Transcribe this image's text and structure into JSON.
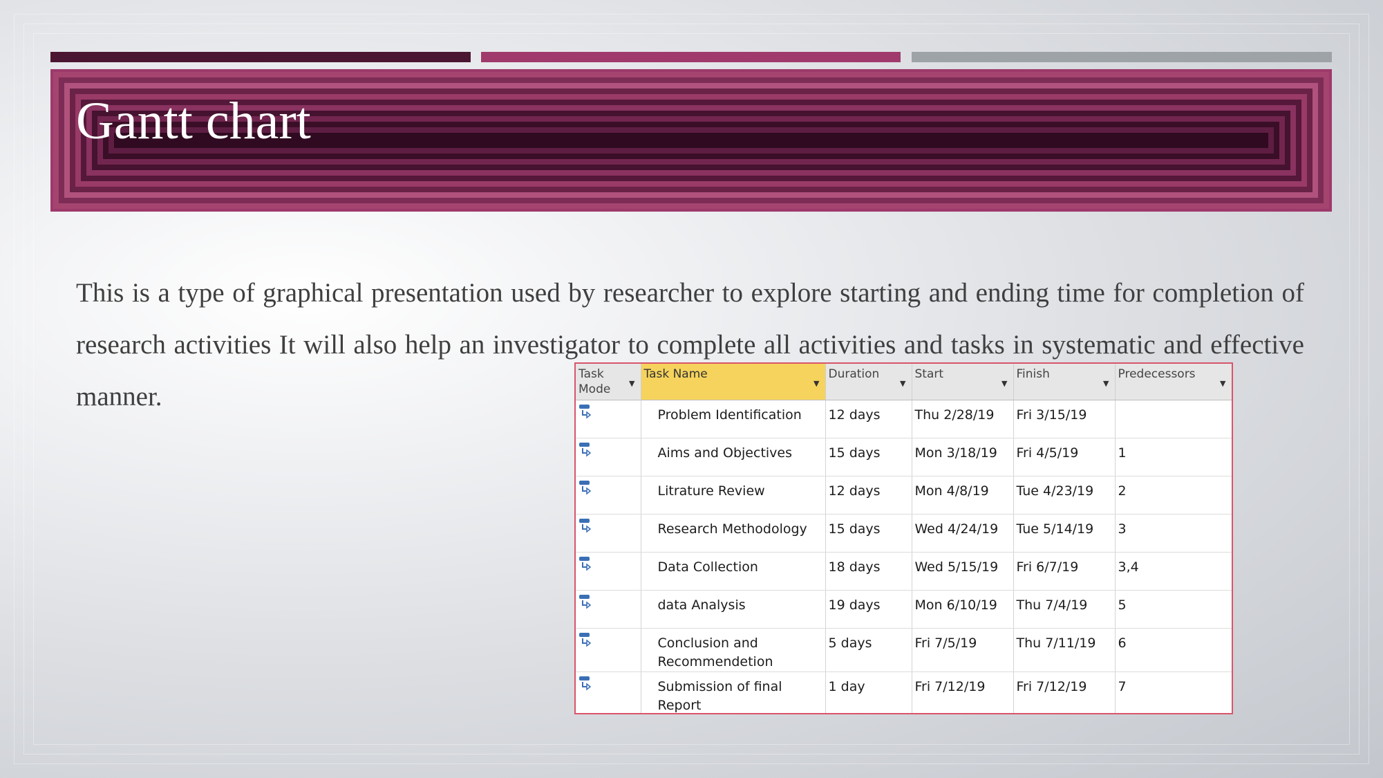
{
  "slide": {
    "title": "Gantt chart",
    "body": "This is a type of graphical presentation used by researcher to explore starting and ending time for completion of research activities It will also help an investigator to complete all activities and tasks in systematic and effective manner."
  },
  "colors": {
    "bar_dark": "#4b1631",
    "bar_magenta": "#a03a6c",
    "bar_gray": "#9ea3a8",
    "banner": "#9d3a6b",
    "table_border": "#d9546b",
    "header_highlight": "#f6d35c"
  },
  "table": {
    "headers": {
      "task_mode": "Task Mode",
      "task_name": "Task Name",
      "duration": "Duration",
      "start": "Start",
      "finish": "Finish",
      "predecessors": "Predecessors"
    },
    "task_mode_icon": "auto-scheduled-task-icon",
    "rows": [
      {
        "name": "Problem Identification",
        "duration": "12 days",
        "start": "Thu 2/28/19",
        "finish": "Fri 3/15/19",
        "predecessors": ""
      },
      {
        "name": "Aims and Objectives",
        "duration": "15 days",
        "start": "Mon 3/18/19",
        "finish": "Fri 4/5/19",
        "predecessors": "1"
      },
      {
        "name": "Litrature Review",
        "duration": "12 days",
        "start": "Mon 4/8/19",
        "finish": "Tue 4/23/19",
        "predecessors": "2"
      },
      {
        "name": "Research Methodology",
        "duration": "15 days",
        "start": "Wed 4/24/19",
        "finish": "Tue 5/14/19",
        "predecessors": "3"
      },
      {
        "name": "Data Collection",
        "duration": "18 days",
        "start": "Wed 5/15/19",
        "finish": "Fri 6/7/19",
        "predecessors": "3,4"
      },
      {
        "name": "data Analysis",
        "duration": "19 days",
        "start": "Mon 6/10/19",
        "finish": "Thu 7/4/19",
        "predecessors": "5"
      },
      {
        "name": "Conclusion and Recommendetion",
        "duration": "5 days",
        "start": "Fri 7/5/19",
        "finish": "Thu 7/11/19",
        "predecessors": "6"
      },
      {
        "name": "Submission of final Report",
        "duration": "1 day",
        "start": "Fri 7/12/19",
        "finish": "Fri 7/12/19",
        "predecessors": "7"
      }
    ]
  }
}
